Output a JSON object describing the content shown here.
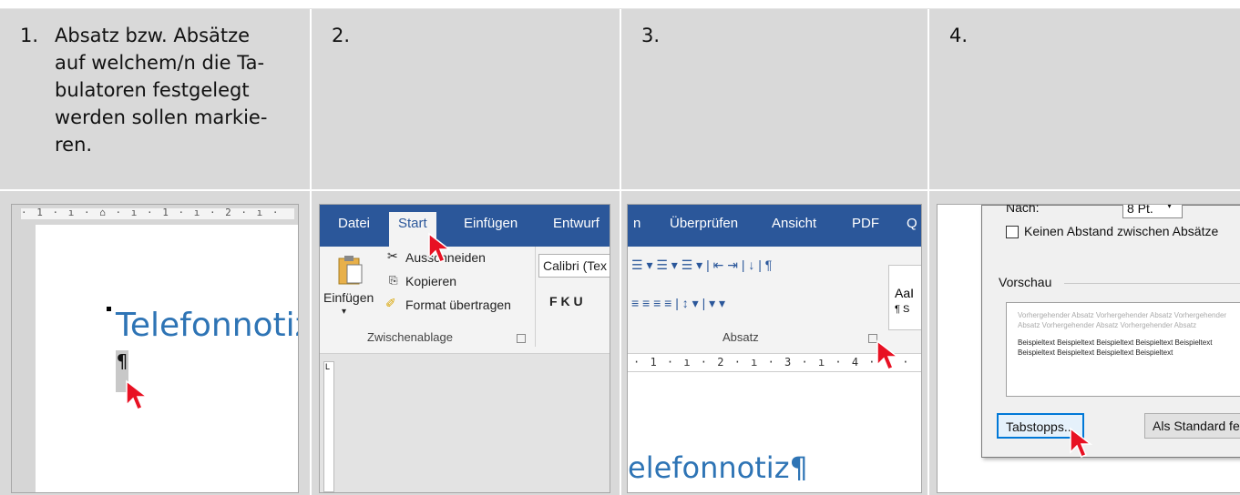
{
  "steps": [
    {
      "number": "1.",
      "text": "Absatz bzw. Absätze auf welchem/n die Ta-bulatoren festgelegt werden sollen markie-ren."
    },
    {
      "number": "2.",
      "text": ""
    },
    {
      "number": "3.",
      "text": ""
    },
    {
      "number": "4.",
      "text": ""
    }
  ],
  "shot1": {
    "ruler_text": "· 1 · ı · ⌂ · ı · 1 · ı · 2 · ı ·",
    "heading_text": "Telefonnotiz",
    "pilcrow": "¶"
  },
  "shot2": {
    "tabs": [
      "Datei",
      "Start",
      "Einfügen",
      "Entwurf"
    ],
    "cut": "Ausschneiden",
    "copy": "Kopieren",
    "format_painter": "Format übertragen",
    "paste": "Einfügen",
    "font_name": "Calibri (Tex",
    "font_buttons": "F  K  U",
    "group_label": "Zwischenablage",
    "vruler_mark": "L"
  },
  "shot3": {
    "tabs": [
      "n",
      "Überprüfen",
      "Ansicht",
      "PDF",
      "Q"
    ],
    "list_icons": "☰ ▾  ☰ ▾  ☰ ▾  |  ⇤  ⇥  |  ↓  |  ¶",
    "align_icons": "≡  ≡  ≡  ≡  |  ↕ ▾  |  ▾  ▾",
    "group_label": "Absatz",
    "ruler_text": "· 1 · ı · 2 · ı · 3 · ı · 4 · ı ·",
    "style_text": "AaI",
    "style_sub": "¶ S",
    "heading_text": "elefonnotiz¶"
  },
  "shot4": {
    "after_label": "Nach:",
    "after_value": "8 Pt.",
    "no_space_label": "Keinen Abstand zwischen Absätze",
    "preview_label": "Vorschau",
    "preview_grey": "Vorhergehender Absatz Vorhergehender Absatz Vorhergehender Absatz Vorhergehender Absatz Vorhergehender Absatz",
    "preview_dark": "Beispieltext Beispieltext Beispieltext Beispieltext Beispieltext Beispieltext Beispieltext Beispieltext Beispieltext",
    "tabstops_button": "Tabstopps...",
    "default_button": "Als Standard fe"
  },
  "colors": {
    "word_blue": "#2b579a",
    "heading_blue": "#2e74b5",
    "cell_grey": "#d9d9d9",
    "cursor_red": "#e81123"
  }
}
